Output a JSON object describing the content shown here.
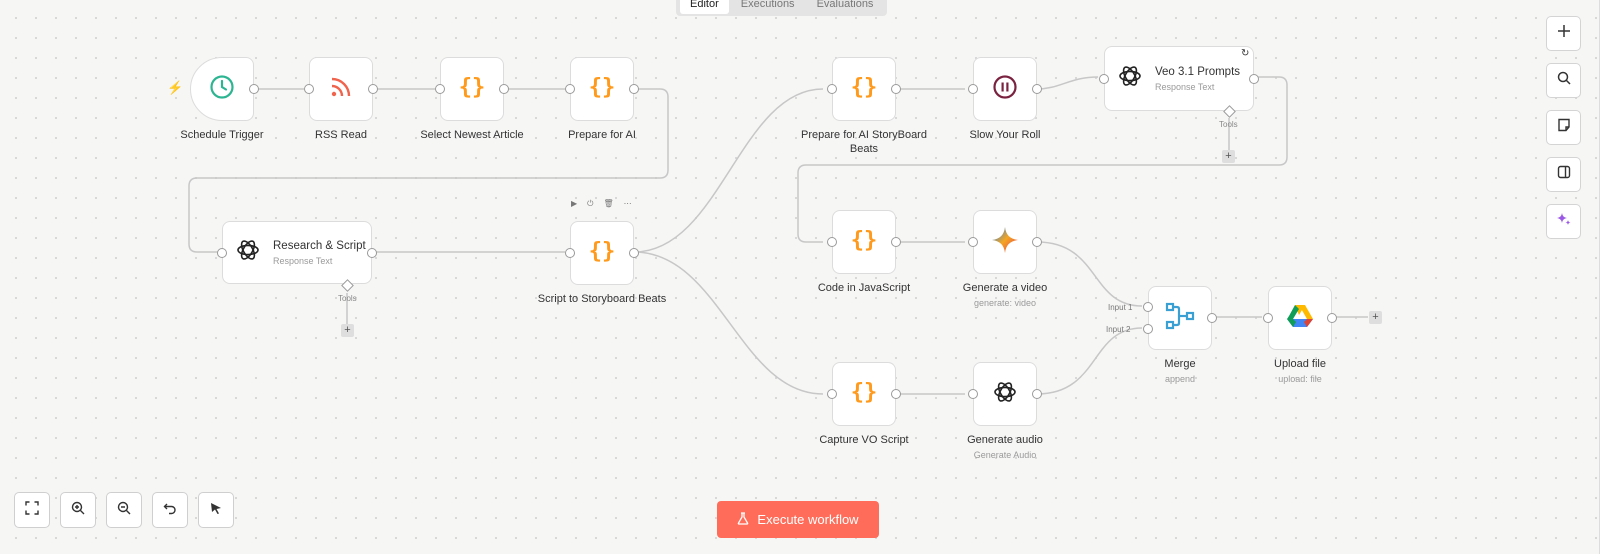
{
  "tabs": [
    {
      "label": "Editor",
      "active": true
    },
    {
      "label": "Executions",
      "active": false
    },
    {
      "label": "Evaluations",
      "active": false
    }
  ],
  "nodes": {
    "schedule_trigger": {
      "label": "Schedule Trigger",
      "icon": "clock-icon"
    },
    "rss_read": {
      "label": "RSS Read",
      "icon": "rss-icon"
    },
    "select_newest": {
      "label": "Select Newest Article",
      "icon": "code-braces-icon"
    },
    "prepare_ai": {
      "label": "Prepare for AI",
      "icon": "code-braces-icon"
    },
    "research_script": {
      "label": "Research & Script",
      "sub": "Response Text",
      "tools": "Tools",
      "icon": "openai-icon"
    },
    "script_storyboard": {
      "label": "Script to Storyboard Beats",
      "icon": "code-braces-icon"
    },
    "prepare_beats": {
      "label": "Prepare for AI StoryBoard Beats",
      "icon": "code-braces-icon"
    },
    "slow_roll": {
      "label": "Slow Your Roll",
      "icon": "pause-icon"
    },
    "veo_prompts": {
      "label": "Veo 3.1 Prompts",
      "sub": "Response Text",
      "tools": "Tools",
      "icon": "openai-icon"
    },
    "code_js": {
      "label": "Code in JavaScript",
      "icon": "code-braces-icon"
    },
    "generate_video": {
      "label": "Generate a video",
      "sub": "generate: video",
      "icon": "gemini-icon"
    },
    "capture_vo": {
      "label": "Capture VO Script",
      "icon": "code-braces-icon"
    },
    "generate_audio": {
      "label": "Generate audio",
      "sub": "Generate Audio",
      "icon": "openai-icon"
    },
    "merge": {
      "label": "Merge",
      "sub": "append",
      "input1": "Input 1",
      "input2": "Input 2",
      "icon": "merge-icon"
    },
    "upload_file": {
      "label": "Upload file",
      "sub": "upload: file",
      "icon": "google-drive-icon"
    }
  },
  "plus_symbol": "+",
  "execute_button": {
    "label": "Execute workflow",
    "icon": "flask-icon"
  },
  "right_toolbar": [
    "plus-icon",
    "search-icon",
    "sticky-note-icon",
    "panel-icon",
    "sparkle-icon"
  ],
  "bottom_toolbar": [
    "fit-view-icon",
    "zoom-in-icon",
    "zoom-out-icon",
    "undo-icon",
    "tidy-icon"
  ],
  "colors": {
    "accent": "#ff6d5a",
    "code_orange": "#ff9a1c",
    "clock_green": "#2db592",
    "rss_orange": "#f0634c",
    "pause_maroon": "#7a2340",
    "merge_blue": "#3aa0d4",
    "sparkle_purple": "#9b59e6"
  }
}
